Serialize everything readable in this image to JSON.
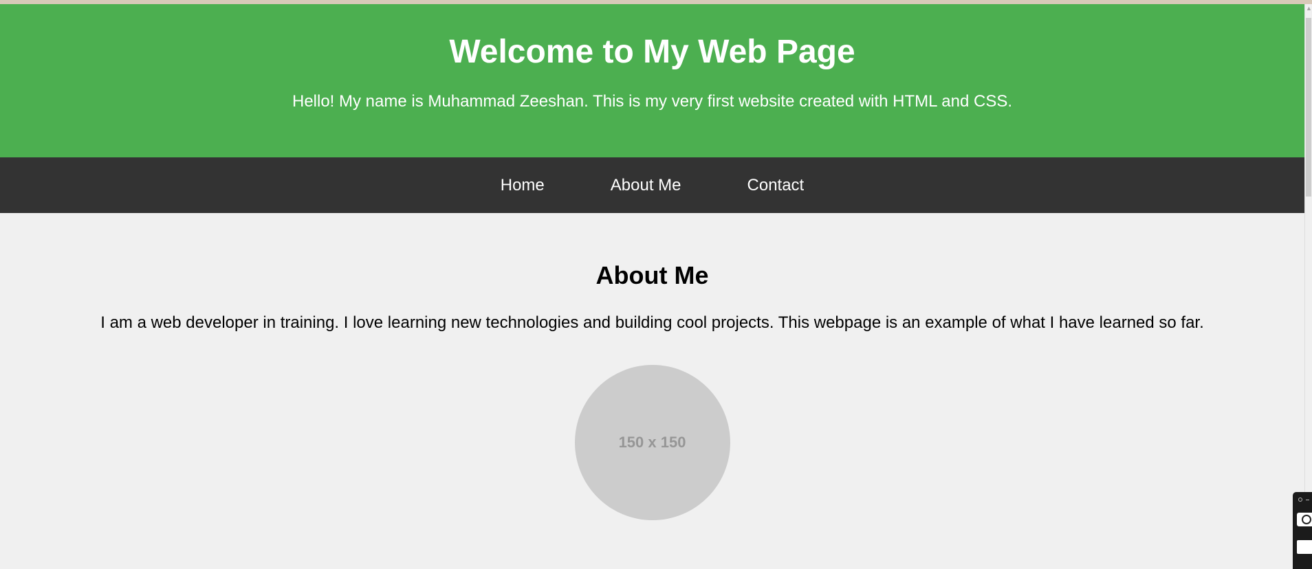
{
  "header": {
    "title": "Welcome to My Web Page",
    "intro": "Hello! My name is Muhammad Zeeshan. This is my very first website created with HTML and CSS."
  },
  "nav": {
    "items": [
      {
        "label": "Home"
      },
      {
        "label": "About Me"
      },
      {
        "label": "Contact"
      }
    ]
  },
  "about": {
    "heading": "About Me",
    "text": "I am a web developer in training. I love learning new technologies and building cool projects. This webpage is an example of what I have learned so far.",
    "avatar_placeholder": "150 x 150"
  },
  "colors": {
    "header_bg": "#4caf50",
    "nav_bg": "#333333",
    "page_bg": "#f0f0f0",
    "avatar_bg": "#cccccc"
  },
  "icons": {
    "scroll_up": "scroll-up-arrow-icon",
    "toolbar_camera": "camera-icon",
    "toolbar_box": "square-icon"
  }
}
